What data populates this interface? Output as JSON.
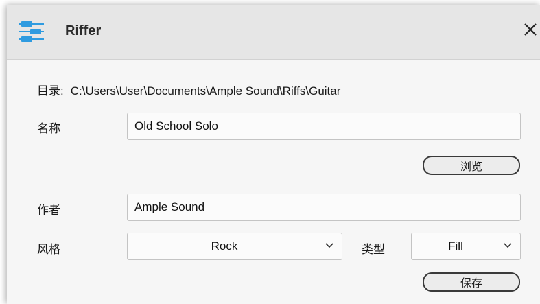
{
  "window": {
    "title": "Riffer"
  },
  "directory": {
    "label": "目录:",
    "path": "C:\\Users\\User\\Documents\\Ample Sound\\Riffs\\Guitar"
  },
  "name": {
    "label": "名称",
    "value": "Old School Solo"
  },
  "browse": {
    "label": "浏览"
  },
  "author": {
    "label": "作者",
    "value": "Ample Sound"
  },
  "style": {
    "label": "风格",
    "value": "Rock"
  },
  "type": {
    "label": "类型",
    "value": "Fill"
  },
  "save": {
    "label": "保存"
  },
  "colors": {
    "app_icon": "#2f9be0",
    "titlebar": "#e6e6e6",
    "background": "#f6f6f6"
  }
}
